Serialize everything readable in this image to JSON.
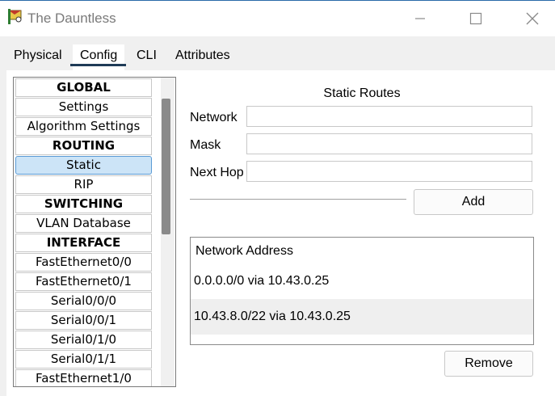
{
  "window": {
    "title": "The Dauntless",
    "icon": "packet-tracer-router-icon"
  },
  "tabs": [
    {
      "label": "Physical",
      "active": false
    },
    {
      "label": "Config",
      "active": true
    },
    {
      "label": "CLI",
      "active": false
    },
    {
      "label": "Attributes",
      "active": false
    }
  ],
  "sidebar": {
    "items": [
      {
        "label": "GLOBAL",
        "type": "header"
      },
      {
        "label": "Settings",
        "type": "item"
      },
      {
        "label": "Algorithm Settings",
        "type": "item"
      },
      {
        "label": "ROUTING",
        "type": "header"
      },
      {
        "label": "Static",
        "type": "item",
        "selected": true
      },
      {
        "label": "RIP",
        "type": "item"
      },
      {
        "label": "SWITCHING",
        "type": "header"
      },
      {
        "label": "VLAN Database",
        "type": "item"
      },
      {
        "label": "INTERFACE",
        "type": "header"
      },
      {
        "label": "FastEthernet0/0",
        "type": "item"
      },
      {
        "label": "FastEthernet0/1",
        "type": "item"
      },
      {
        "label": "Serial0/0/0",
        "type": "item"
      },
      {
        "label": "Serial0/0/1",
        "type": "item"
      },
      {
        "label": "Serial0/1/0",
        "type": "item"
      },
      {
        "label": "Serial0/1/1",
        "type": "item"
      },
      {
        "label": "FastEthernet1/0",
        "type": "item"
      }
    ]
  },
  "static_routes": {
    "title": "Static Routes",
    "network_label": "Network",
    "network_value": "",
    "mask_label": "Mask",
    "mask_value": "",
    "next_hop_label": "Next Hop",
    "next_hop_value": "",
    "add_label": "Add",
    "list_header": "Network Address",
    "routes": [
      "0.0.0.0/0 via 10.43.0.25",
      "10.43.8.0/22 via 10.43.0.25"
    ],
    "remove_label": "Remove"
  },
  "colors": {
    "selected_bg": "#cce4f7",
    "tab_underline": "#1f3b57",
    "window_bg": "#f0f0f0"
  }
}
